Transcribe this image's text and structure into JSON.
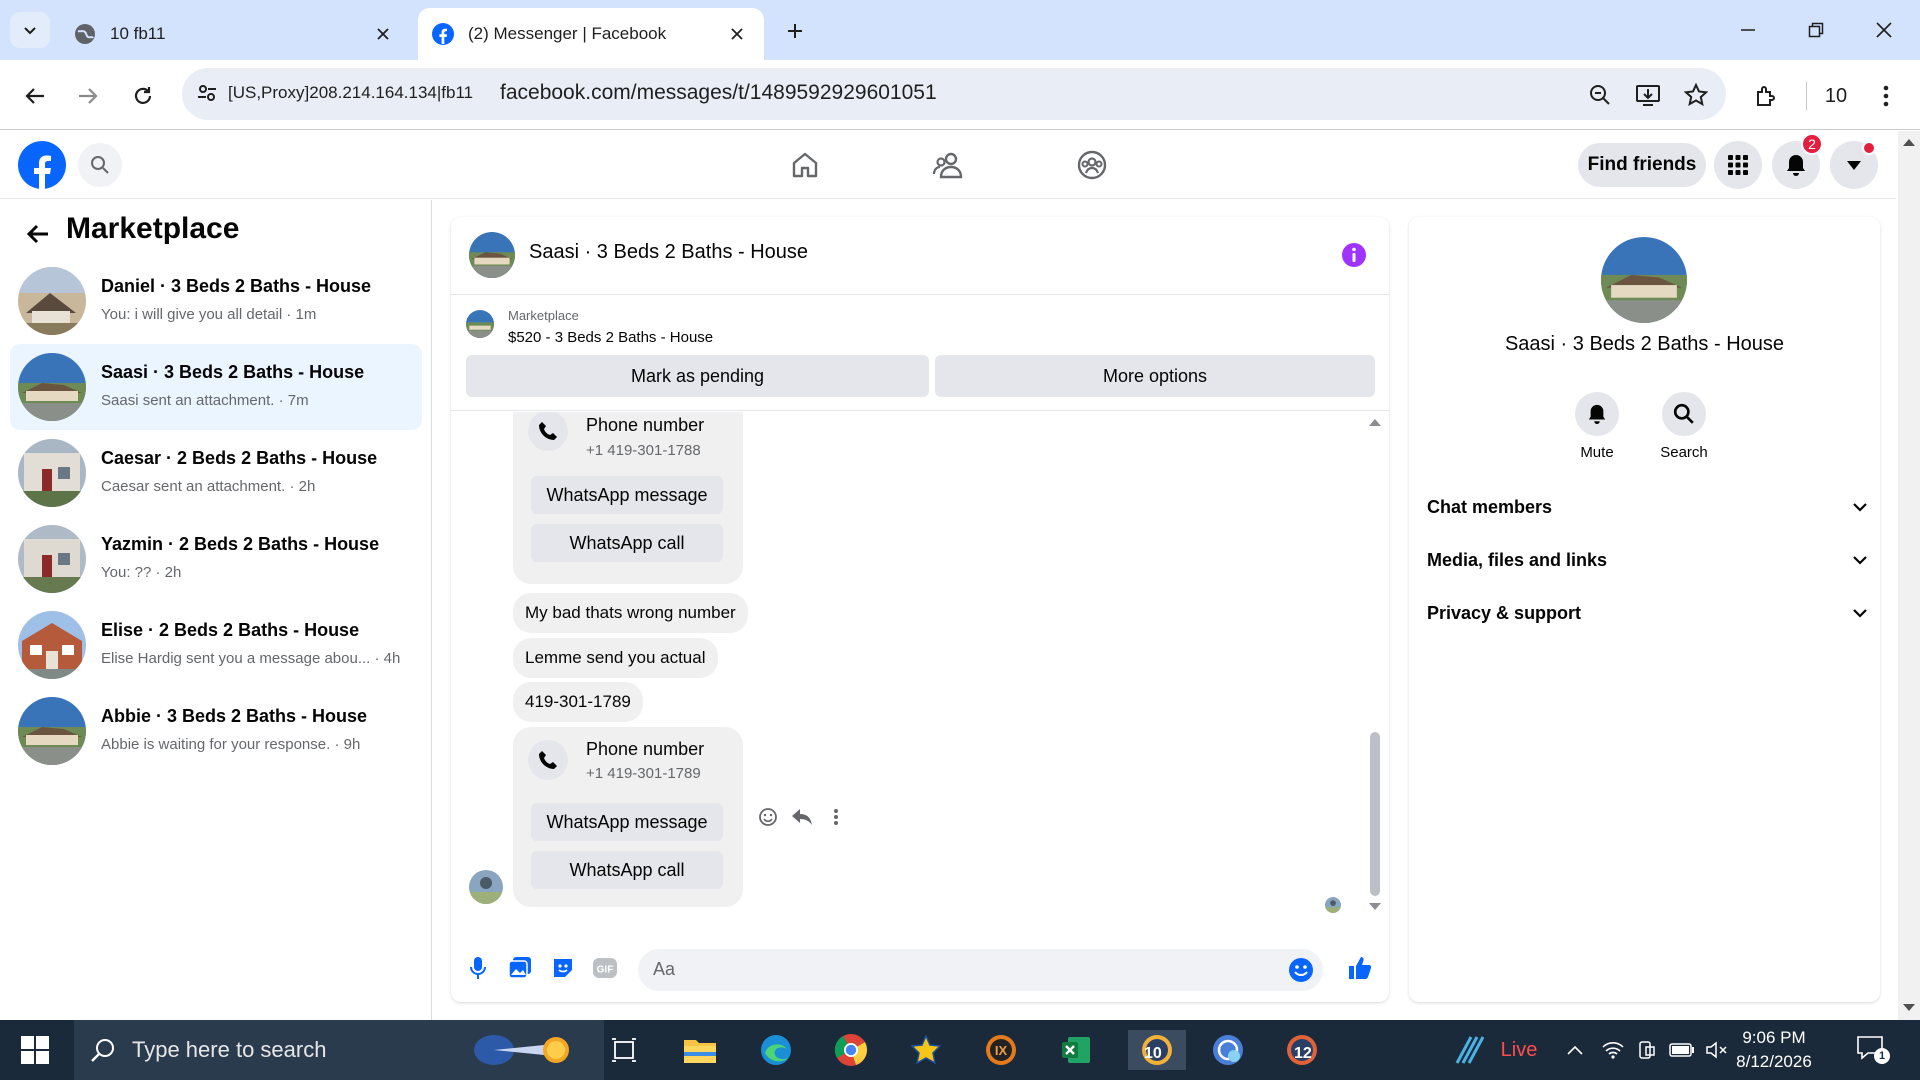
{
  "browser": {
    "tabs": [
      {
        "title": "10 fb11"
      },
      {
        "title": "(2) Messenger | Facebook"
      }
    ],
    "site_info": "[US,Proxy]208.214.164.134|fb11",
    "url": "facebook.com/messages/t/1489592929601051",
    "profile_label": "10"
  },
  "header": {
    "find_friends": "Find friends",
    "notification_count": "2"
  },
  "sidebar": {
    "title": "Marketplace",
    "conversations": [
      {
        "name": "Daniel · 3 Beds 2 Baths - House",
        "preview": "You: i will give you all detail · 1m"
      },
      {
        "name": "Saasi · 3 Beds 2 Baths - House",
        "preview": "Saasi sent an attachment. · 7m"
      },
      {
        "name": "Caesar · 2 Beds 2 Baths - House",
        "preview": "Caesar sent an attachment. · 2h"
      },
      {
        "name": "Yazmin · 2 Beds 2 Baths - House",
        "preview": "You: ?? · 2h"
      },
      {
        "name": "Elise · 2 Beds 2 Baths - House",
        "preview": "Elise Hardig sent you a message abou... · 4h"
      },
      {
        "name": "Abbie · 3 Beds 2 Baths - House",
        "preview": "Abbie is waiting for your response. · 9h"
      }
    ]
  },
  "chat": {
    "title": "Saasi · 3 Beds 2 Baths - House",
    "marketplace_label": "Marketplace",
    "listing": "$520 - 3 Beds 2 Baths - House",
    "mark_pending": "Mark as pending",
    "more_options": "More options",
    "card1": {
      "title": "Phone number",
      "number": "+1 419-301-1788",
      "btn_msg": "WhatsApp message",
      "btn_call": "WhatsApp call"
    },
    "messages": [
      "My bad thats wrong number",
      "Lemme send you actual",
      "419-301-1789"
    ],
    "card2": {
      "title": "Phone number",
      "number": "+1 419-301-1789",
      "btn_msg": "WhatsApp message",
      "btn_call": "WhatsApp call"
    },
    "composer_placeholder": "Aa"
  },
  "right_panel": {
    "name": "Saasi · 3 Beds 2 Baths - House",
    "mute": "Mute",
    "search": "Search",
    "sections": [
      "Chat members",
      "Media, files and links",
      "Privacy & support"
    ]
  },
  "taskbar": {
    "search_placeholder": "Type here to search",
    "live": "Live",
    "time": "9:06 PM",
    "date": "8/12/2026",
    "notif_count": "1",
    "badge_10": "10",
    "badge_12": "12"
  },
  "colors": {
    "fb_blue": "#0866ff",
    "messenger_purple": "#a033ff",
    "tab_strip": "#d3e3fd",
    "active_conv": "#ebf5ff",
    "taskbar": "#1b2a3a"
  }
}
